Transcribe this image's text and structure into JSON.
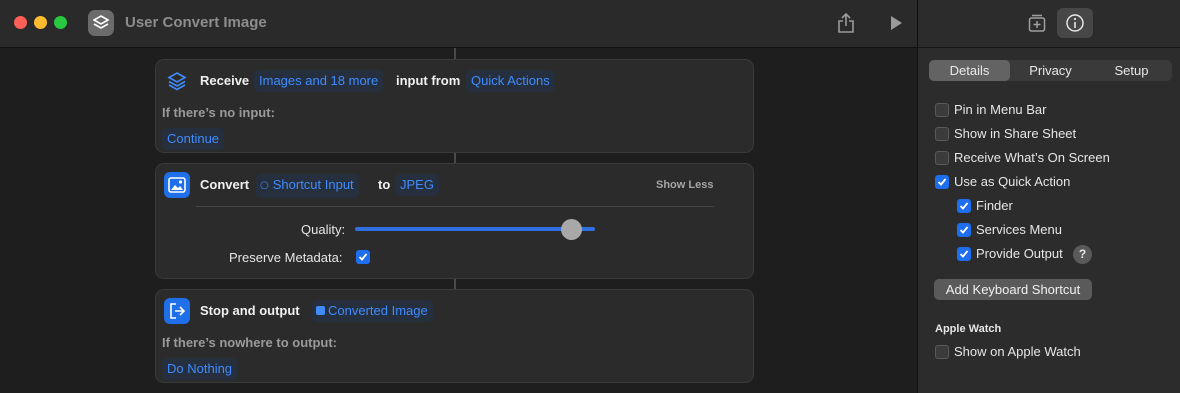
{
  "window": {
    "title": "User Convert Image"
  },
  "cards": {
    "receive": {
      "label": "Receive",
      "types_token": "Images and 18 more",
      "mid_label": "input from",
      "source_token": "Quick Actions",
      "no_input_label": "If there’s no input:",
      "no_input_token": "Continue"
    },
    "convert": {
      "label": "Convert",
      "input_token": "Shortcut Input",
      "to_label": "to",
      "format_token": "JPEG",
      "show_less": "Show Less",
      "quality_label": "Quality:",
      "quality_value": 0.9,
      "preserve_label": "Preserve Metadata:",
      "preserve_checked": true
    },
    "output": {
      "label": "Stop and output",
      "value_token": "Converted Image",
      "nowhere_label": "If there’s nowhere to output:",
      "nowhere_token": "Do Nothing"
    }
  },
  "inspector": {
    "tabs": [
      "Details",
      "Privacy",
      "Setup"
    ],
    "active_tab": "Details",
    "options": {
      "pin_menu_bar": {
        "label": "Pin in Menu Bar",
        "checked": false
      },
      "share_sheet": {
        "label": "Show in Share Sheet",
        "checked": false
      },
      "whats_on_screen": {
        "label": "Receive What’s On Screen",
        "checked": false
      },
      "quick_action": {
        "label": "Use as Quick Action",
        "checked": true
      },
      "finder": {
        "label": "Finder",
        "checked": true
      },
      "services_menu": {
        "label": "Services Menu",
        "checked": true
      },
      "provide_output": {
        "label": "Provide Output",
        "checked": true
      }
    },
    "help_glyph": "?",
    "keyboard_shortcut_button": "Add Keyboard Shortcut",
    "apple_watch_heading": "Apple Watch",
    "apple_watch": {
      "label": "Show on Apple Watch",
      "checked": false
    }
  },
  "colors": {
    "accent": "#3f8cff",
    "checkbox_on": "#1e6ef0",
    "card_bg": "#2b2b2b",
    "panel_bg": "#2c2c2c"
  },
  "icons": {
    "app": "shortcuts-icon",
    "share": "share-icon",
    "run": "play-icon",
    "library": "add-to-library-icon",
    "info": "info-icon",
    "receive": "layers-icon",
    "convert": "image-icon",
    "output": "exit-icon"
  }
}
